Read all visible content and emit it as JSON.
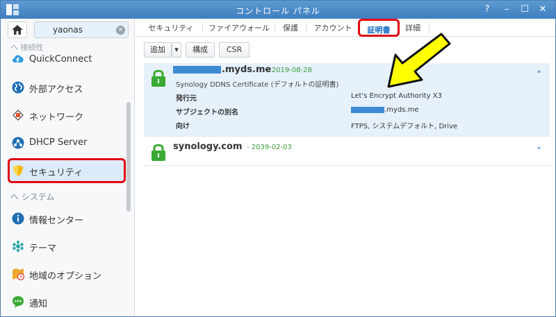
{
  "window": {
    "title": "コントロール パネル",
    "help_glyph": "?",
    "minimize_glyph": "–",
    "maximize_glyph": "☐",
    "close_glyph": "✕"
  },
  "sidebar": {
    "search_value": "yaonas",
    "clear_glyph": "⨯",
    "faded_label": "ヘ 接続性",
    "items": [
      {
        "label": "QuickConnect",
        "icon": "quickconnect-icon"
      },
      {
        "label": "外部アクセス",
        "icon": "globe-icon"
      },
      {
        "label": "ネットワーク",
        "icon": "network-icon"
      },
      {
        "label": "DHCP Server",
        "icon": "dhcp-icon"
      },
      {
        "label": "セキュリティ",
        "icon": "shield-icon"
      },
      {
        "label": "情報センター",
        "icon": "info-icon"
      },
      {
        "label": "テーマ",
        "icon": "palette-icon"
      },
      {
        "label": "地域のオプション",
        "icon": "region-icon"
      },
      {
        "label": "通知",
        "icon": "notification-icon"
      }
    ],
    "section_system": "ヘ システム"
  },
  "tabs": [
    {
      "label": "セキュリティ"
    },
    {
      "label": "ファイアウォール"
    },
    {
      "label": "保護"
    },
    {
      "label": "アカウント"
    },
    {
      "label": "証明書"
    },
    {
      "label": "詳細"
    }
  ],
  "toolbar": {
    "add": "追加",
    "dropdown_glyph": "▾",
    "config": "構成",
    "csr": "CSR"
  },
  "certs": [
    {
      "name": ".myds.me",
      "date": "- 2019-08-28",
      "issuer_line": "Synology DDNS Certificate (デフォルトの証明書)",
      "fields": [
        {
          "key": "発行元",
          "value": "Let's Encrypt Authority X3"
        },
        {
          "key": "サブジェクトの別名",
          "value": ".myds.me"
        },
        {
          "key": "向け",
          "value": "FTPS, システムデフォルト, Drive"
        }
      ],
      "chevron": "˄"
    },
    {
      "name": "synology.com",
      "date": "- 2039-02-03",
      "chevron": "˅"
    }
  ],
  "colors": {
    "accent": "#1769c2",
    "highlight_red": "#e30613",
    "arrow_yellow": "#ffff00",
    "lock_green": "#3aaa35"
  }
}
